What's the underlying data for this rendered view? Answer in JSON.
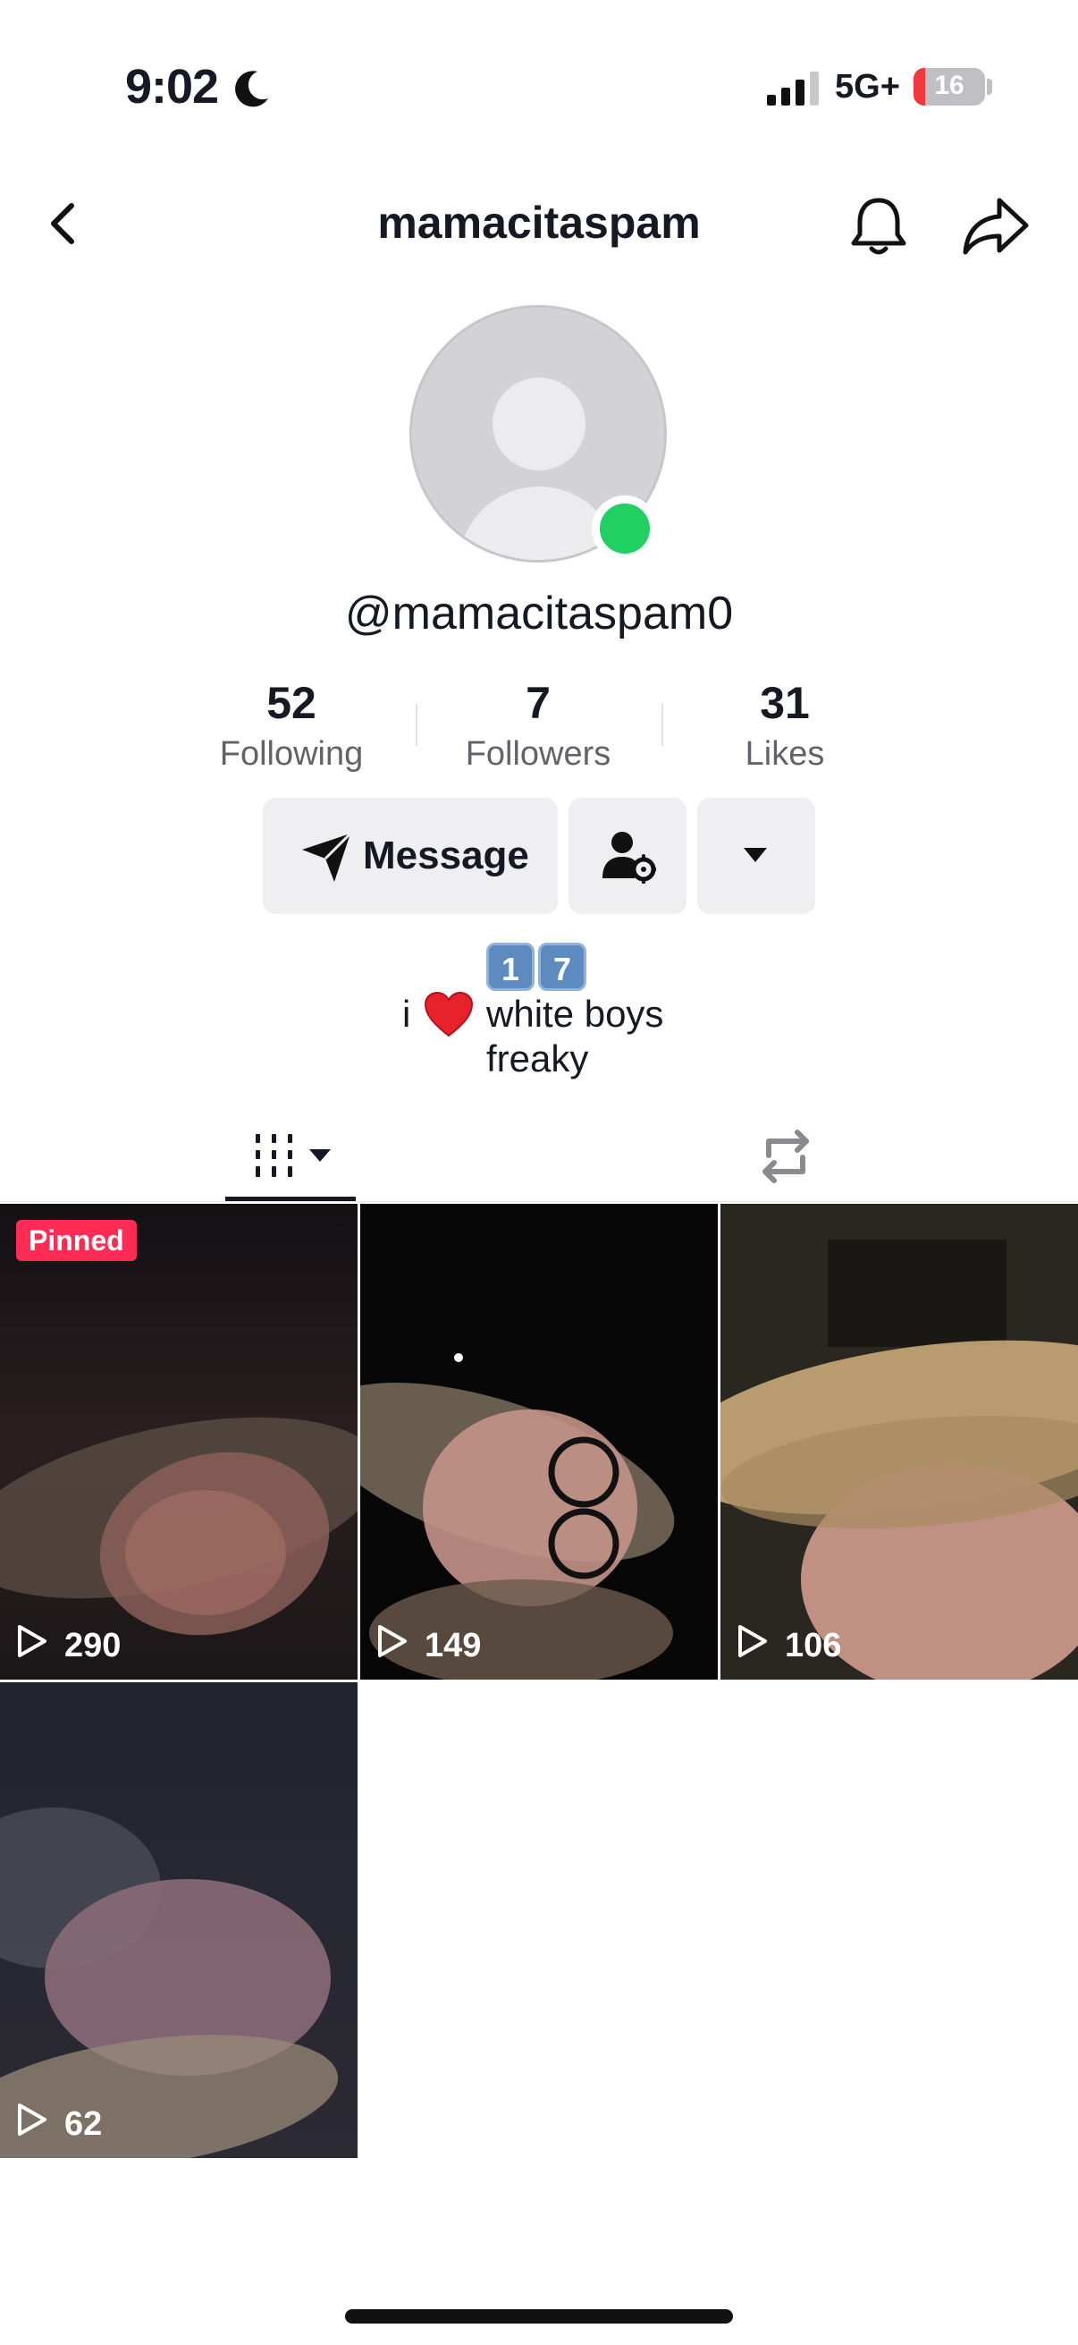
{
  "status_bar": {
    "time": "9:02",
    "network": "5G+",
    "battery": "16",
    "battery_fraction": 0.16
  },
  "header": {
    "title": "mamacitaspam"
  },
  "profile": {
    "username": "@mamacitaspam0",
    "stats": [
      {
        "value": "52",
        "label": "Following"
      },
      {
        "value": "7",
        "label": "Followers"
      },
      {
        "value": "31",
        "label": "Likes"
      }
    ]
  },
  "actions": {
    "message_label": "Message"
  },
  "bio": {
    "keycaps": [
      "1",
      "7"
    ],
    "line1_prefix": "i",
    "line1_rest": "white boys",
    "line2": "freaky"
  },
  "videos": [
    {
      "views": "290",
      "pinned": true,
      "pinned_label": "Pinned"
    },
    {
      "views": "149",
      "pinned": false
    },
    {
      "views": "106",
      "pinned": false
    },
    {
      "views": "62",
      "pinned": false
    }
  ],
  "colors": {
    "accent": "#fe2c55",
    "online": "#20d060",
    "text": "#161823",
    "secondary_text": "#626269",
    "button_bg": "#efeff1"
  },
  "icons": [
    "moon-icon",
    "signal-icon",
    "back-icon",
    "bell-icon",
    "share-icon",
    "send-icon",
    "person-gear-icon",
    "caret-down-icon",
    "heart-icon",
    "grid-icon",
    "repost-icon",
    "play-icon"
  ]
}
